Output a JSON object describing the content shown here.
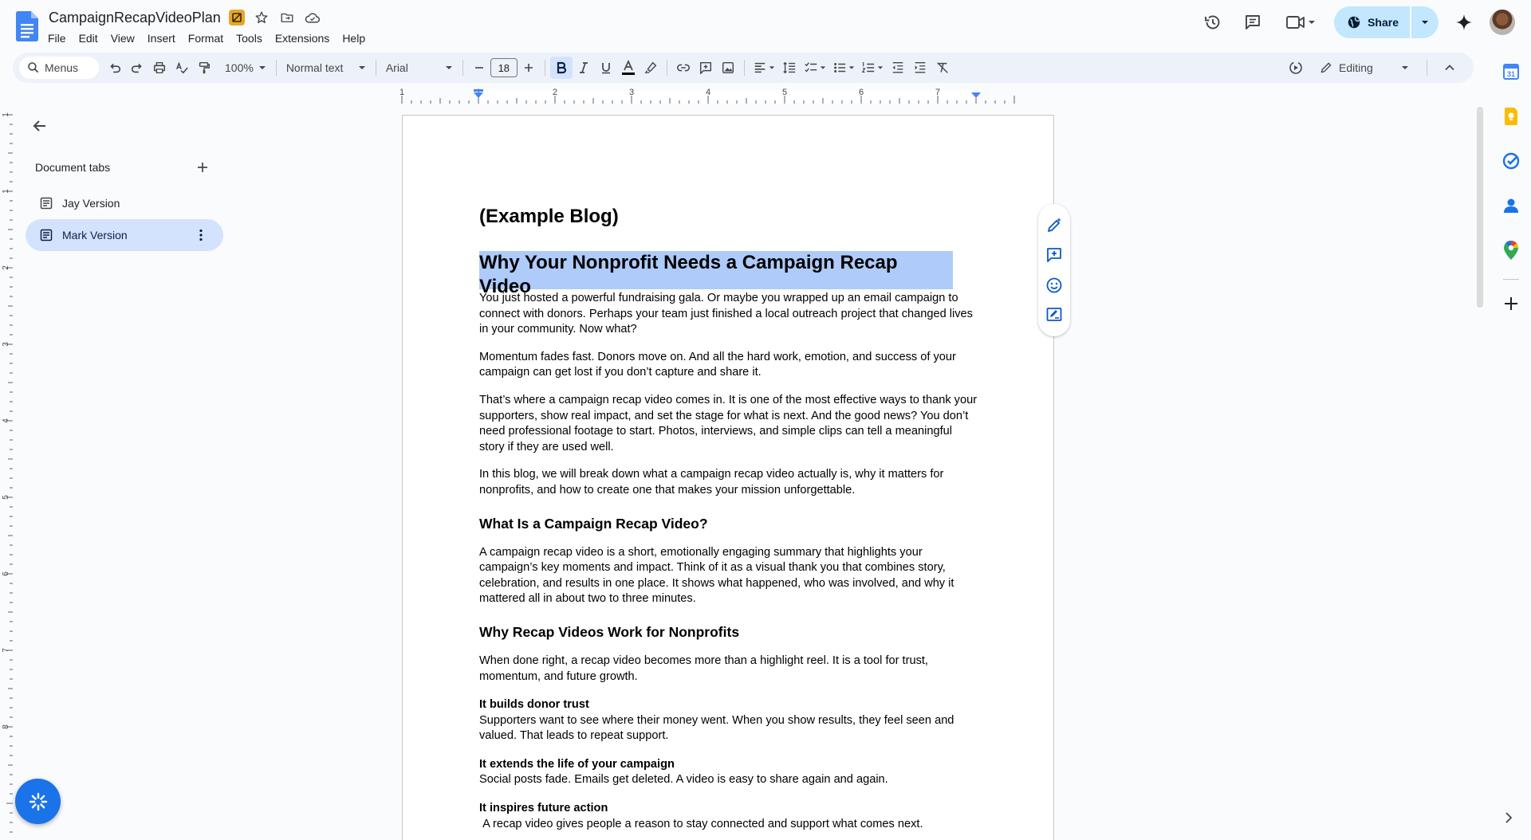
{
  "app": {
    "doc_title": "CampaignRecapVideoPlan"
  },
  "menu": [
    "File",
    "Edit",
    "View",
    "Insert",
    "Format",
    "Tools",
    "Extensions",
    "Help"
  ],
  "header_actions": {
    "share_label": "Share"
  },
  "toolbar": {
    "search_label": "Menus",
    "zoom": "100%",
    "style": "Normal text",
    "font": "Arial",
    "font_size": "18",
    "mode": "Editing"
  },
  "ruler": {
    "labels": [
      "1",
      "1",
      "2",
      "3",
      "4",
      "5",
      "6",
      "7"
    ],
    "vlabels": [
      "1",
      "1",
      "2",
      "3",
      "4",
      "5",
      "6",
      "7",
      "8"
    ]
  },
  "sidebar": {
    "title": "Document tabs",
    "tabs": [
      {
        "label": "Jay Version",
        "selected": false
      },
      {
        "label": "Mark Version",
        "selected": true
      }
    ]
  },
  "document": {
    "example": "(Example Blog)",
    "h1": "Why Your Nonprofit Needs a Campaign Recap Video",
    "p1": "You just hosted a powerful fundraising gala. Or maybe you wrapped up an email campaign to connect with donors. Perhaps your team just finished a local outreach project that changed lives in your community. Now what?",
    "p2": "Momentum fades fast. Donors move on. And all the hard work, emotion, and success of your campaign can get lost if you don’t capture and share it.",
    "p3": "That’s where a campaign recap video comes in. It is one of the most effective ways to thank your supporters, show real impact, and set the stage for what is next. And the good news? You don’t need professional footage to start. Photos, interviews, and simple clips can tell a meaningful story if they are used well.",
    "p4": "In this blog, we will break down what a campaign recap video actually is, why it matters for nonprofits, and how to create one that makes your mission unforgettable.",
    "h2a": "What Is a Campaign Recap Video?",
    "p5": "A campaign recap video is a short, emotionally engaging summary that highlights your campaign’s key moments and impact. Think of it as a visual thank you that combines story, celebration, and results in one place. It shows what happened, who was involved, and why it mattered all in about two to three minutes.",
    "h2b": "Why Recap Videos Work for Nonprofits",
    "p6": "When done right, a recap video becomes more than a highlight reel. It is a tool for trust, momentum, and future growth.",
    "b1": "It builds donor trust",
    "p7": "Supporters want to see where their money went. When you show results, they feel seen and valued. That leads to repeat support.",
    "b2": "It extends the life of your campaign",
    "p8": "Social posts fade. Emails get deleted. A video is easy to share again and again.",
    "b3": "It inspires future action",
    "p9": " A recap video gives people a reason to stay connected and support what comes next."
  },
  "colors": {
    "accent": "#0b57d0",
    "share_bg": "#c2e7ff",
    "selection": "#aecbfa",
    "toolbar_bg": "#edf2fa"
  }
}
